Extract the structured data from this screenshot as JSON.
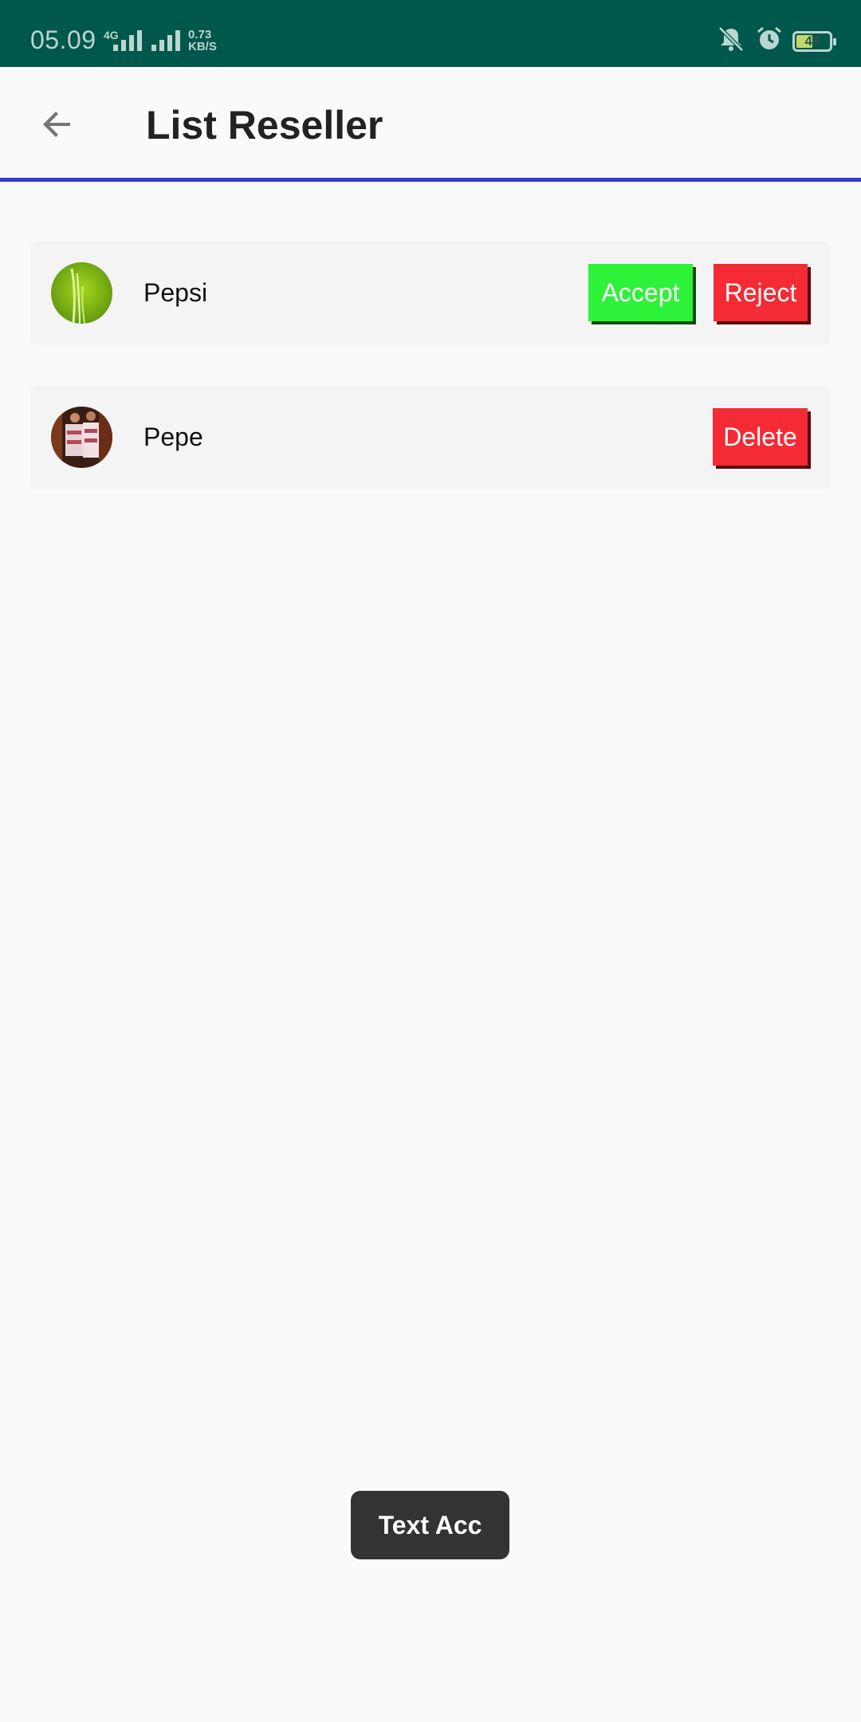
{
  "status_bar": {
    "time": "05.09",
    "network": "4G",
    "speed_value": "0.73",
    "speed_unit": "KB/S",
    "battery": "48"
  },
  "app_bar": {
    "title": "List Reseller",
    "back_icon": "arrow-back-icon"
  },
  "resellers": [
    {
      "name": "Pepsi",
      "avatar": "grass-photo",
      "actions": [
        "Accept",
        "Reject"
      ]
    },
    {
      "name": "Pepe",
      "avatar": "person-photo",
      "actions": [
        "Delete"
      ]
    }
  ],
  "toast": {
    "text": "Text Acc"
  },
  "colors": {
    "status_bar": "#00574b",
    "accent": "#3838d6",
    "accept": "#2ef23a",
    "reject": "#f42a35",
    "toast": "#333333"
  }
}
